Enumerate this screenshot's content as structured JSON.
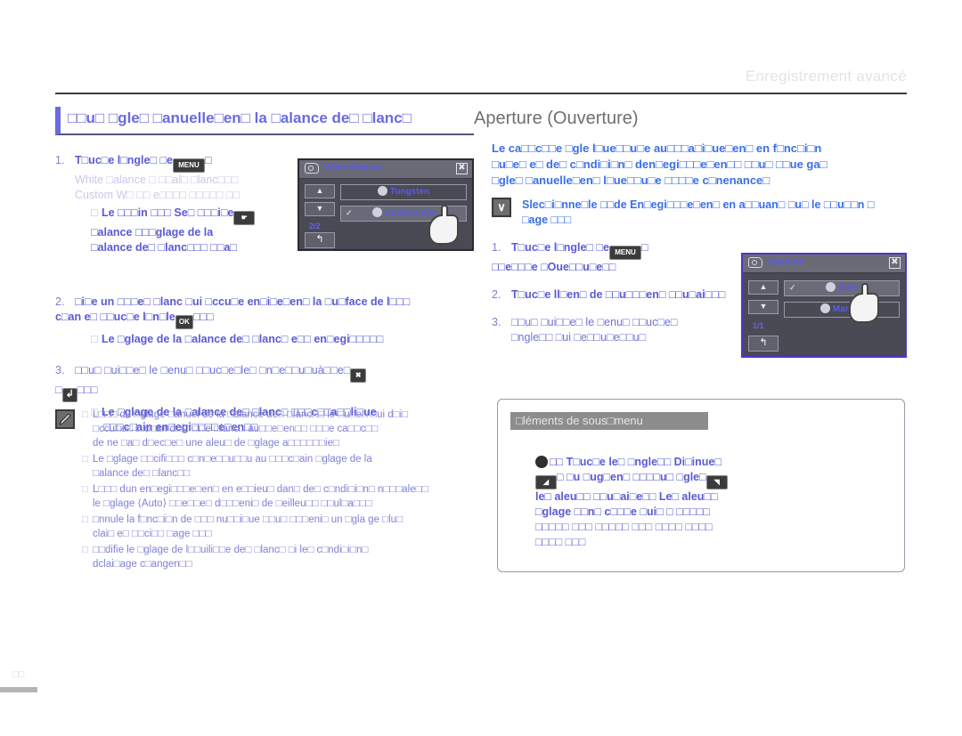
{
  "header": {
    "running_head": "Enregistrement avancé"
  },
  "titles": {
    "left": "□□u□ □gle□ □anuelle□en□ la □alance de□ □lanc□",
    "right": "Aperture (Ouverture)"
  },
  "left_column": {
    "steps": [
      {
        "num": "1.",
        "lines": [
          {
            "text": "T□uc□e l□ngle□ □e",
            "bold": true,
            "icon": "menu-key",
            "icon_label": "MENU",
            "tail": "□"
          },
          {
            "text": "White □alance □ □□al□ □lanc□□□",
            "faint": true
          },
          {
            "text": "Custom W□ □□ e□□□□ □□□□□ □□",
            "faint": true
          }
        ],
        "subs": [
          {
            "text": "Le □□□in □□□ Se□ □□□i□e",
            "bold": true,
            "icon": "hand-key"
          },
          {
            "text": "□alance □□□glage de la",
            "bold": true
          },
          {
            "text": "□alance de□ □lanc□□□ □□a□",
            "bold": true
          }
        ]
      },
      {
        "num": "2.",
        "lines": [
          {
            "text": "□i□e un □□□e□ □lanc □ui □ccu□e en□i□e□en□ la □u□face de l□□□",
            "bold": false
          },
          {
            "text": "c□an e□ □□uc□e l□n□le",
            "bold": true,
            "icon": "ok-key",
            "icon_label": "OK",
            "tail": "□□□"
          }
        ],
        "subs": [
          {
            "text": "Le □glage de la □alance de□ □lanc□ e□□ en□egi□□□□□",
            "bold": true
          }
        ]
      },
      {
        "num": "3.",
        "lines": [
          {
            "text": "□□u□ □ui□□e□ le □enu□ □□uc□e□le□ □n□e□□u□uà□□e□",
            "bold": false
          },
          {
            "text": "□",
            "icon": "back-key",
            "tail": "□□□"
          }
        ],
        "subs": [
          {
            "text": "Le □glage de la □alance de□ □lanc□ □□□c□□a□□li□ue",
            "bold": true
          },
          {
            "text": "□□□c□ain en□egi□□□□e□en□□",
            "bold": true
          }
        ]
      }
    ]
  },
  "right_column": {
    "intro": [
      "Le ca□□c□□e □gle l□ue□□u□e au□□□a□i□ue□en□ en f□nc□i□n",
      "□u□e□ e□ de□ c□ndi□i□n□ den□egi□□□e□en□□ □□u□ □□ue ga□",
      "□gle□ □anuelle□en□ l□ue□□u□e □□□□e c□nenance□"
    ],
    "tip": [
      "Slec□i□nne□le □□de En□egi□□□e□en□ en a□□uan□ □u□ le □□u□□n □",
      "□age □□□"
    ],
    "steps": [
      {
        "num": "1.",
        "lines": [
          {
            "text": "T□uc□e l□ngle□ □e",
            "bold": true,
            "icon": "menu-key",
            "icon_label": "MENU",
            "tail": "□"
          },
          {
            "text": "□□e□□□e □Oue□□u□e□□",
            "bold": true
          }
        ]
      },
      {
        "num": "2.",
        "lines": [
          {
            "text": "T□uc□e ll□en□ de □□u□□□en□ □□u□ai□□□",
            "bold": true
          }
        ]
      },
      {
        "num": "3.",
        "lines": [
          {
            "text": "□□u□ □ui□□e□ le □enu□ □□uc□e□",
            "bold": false
          },
          {
            "text": "□ngle□□ □ui □e□□u□e□□u□",
            "bold": false,
            "icon": "close-key"
          }
        ]
      }
    ]
  },
  "lcd_white_balance": {
    "title": "White Balance",
    "up_label": "▲",
    "down_label": "▼",
    "page_indicator": "2/2",
    "back_label": "↰",
    "items": [
      {
        "label": "Tungsten",
        "checked": false,
        "selected": false
      },
      {
        "label": "Custom WB",
        "checked": true,
        "selected": true
      }
    ]
  },
  "lcd_aperture": {
    "title": "Aperture",
    "up_label": "▲",
    "down_label": "▼",
    "page_indicator": "1/1",
    "back_label": "↰",
    "items": [
      {
        "label": "Auto",
        "checked": true,
        "selected": true
      },
      {
        "label": "Manual",
        "checked": false,
        "selected": false
      }
    ]
  },
  "notes": {
    "items": [
      {
        "lines": [
          "L□□□ du □glage □anuel de la □alance de□ □lanc□□ le □u□e□ □ui d□i□",
          "□ccu□e□ l□c□an d□i□ □□e □lanc□ au□□e□en□□ □□□e ca□□c□□",
          "de ne □a□ d□ec□e□ une aleu□ de □glage a□□□□□□ie□"
        ]
      },
      {
        "lines": [
          "Le □glage □□cifi□□□ c□n□e□□u□□u au □□□c□ain □glage de la",
          "□alance de□ □lanc□□"
        ]
      },
      {
        "lines": [
          "L□□□ dun en□egi□□□e□en□ en e□□ieu□ dan□ de□ c□ndi□i□n□ n□□□ale□□",
          "le □glage ⟨Auto⟩ □□e□□e□ d□□□eni□ de □eilleu□□ □□ul□a□□□"
        ]
      },
      {
        "lines": [
          "□nnule la f□nc□i□n de □□□ nu□□i□ue □□u□ □□□eni□ un □gla ge □lu□",
          "clai□ e□ □□ci□□ □age □□□"
        ]
      },
      {
        "lines": [
          "□□difie le □glage de l□□uili□□e de□ □lanc□ □i le□ c□ndi□i□n□",
          "dclai□age c□angen□□"
        ]
      }
    ]
  },
  "submenu": {
    "heading": "□léments de sous□menu",
    "item": {
      "lines": [
        {
          "text": "□□ T□uc□e le□ □ngle□□ Di□inue□",
          "bold": true,
          "icon": "aperture-icon"
        },
        {
          "text": "□ □u □ug□en□ □□□□u□ □gle□",
          "bold": true,
          "icons": [
            "dec-key",
            "inc-key"
          ]
        },
        {
          "text": "le□ aleu□□ □□u□ai□e□□ Le□ aleu□□",
          "bold": true
        },
        {
          "text": "□glage □□n□ c□□□e □ui□ □ □□□□□",
          "bold": true
        },
        {
          "text": "□□□□□ □□□ □□□□□ □□□ □□□□ □□□□",
          "bold": false
        },
        {
          "text": "□□□□ □□□",
          "bold": false
        }
      ]
    }
  },
  "folio": {
    "page": "□□"
  },
  "colors": {
    "accent_violet": "#6a6ae0",
    "body_blue": "#6f6fd8",
    "intro_blue": "#3b6fe8",
    "lcd_bg": "#4a4a55",
    "lcd_title_bar": "#6b6b78"
  }
}
